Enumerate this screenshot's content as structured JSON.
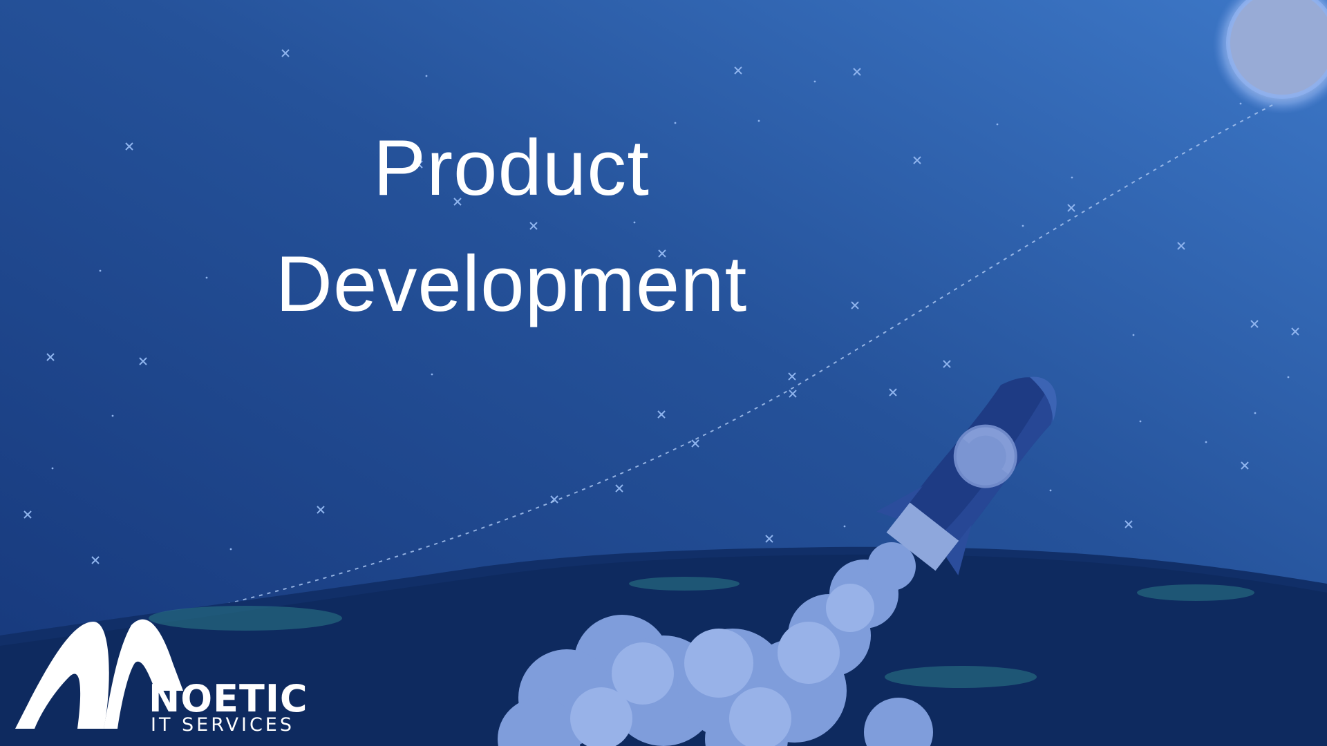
{
  "title": {
    "line1": "Product",
    "line2": "Development"
  },
  "logo": {
    "name": "NOETIC",
    "subtitle": "IT SERVICES"
  },
  "colors": {
    "sky_top": "#3b74c4",
    "sky_bottom": "#173a78",
    "ground": "#0f2d63",
    "rocket_body": "#1c3a82",
    "smoke": "#8fa9e0",
    "moon": "#a8c1ef"
  },
  "icons": [
    "rocket-icon",
    "moon-icon",
    "star-icon",
    "smoke-cloud-icon",
    "noetic-logo-icon"
  ]
}
